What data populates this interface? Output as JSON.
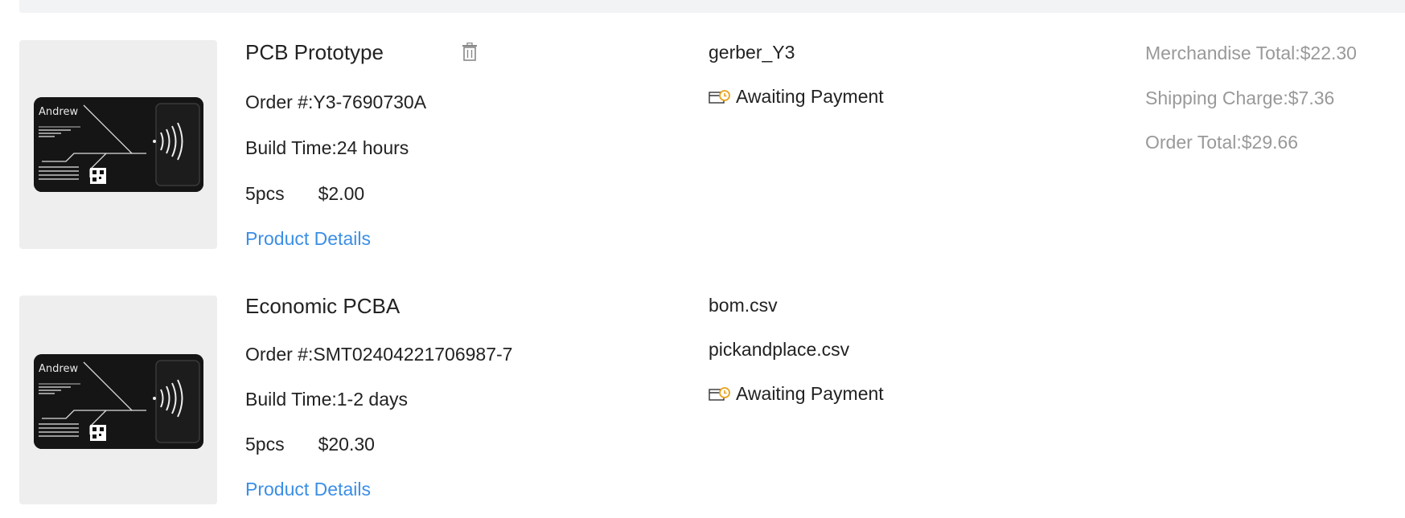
{
  "orders": [
    {
      "product": "PCB Prototype",
      "order_no": "Order #:Y3-7690730A",
      "build_time": "Build Time:24 hours",
      "qty": "5pcs",
      "price": "$2.00",
      "details_link": "Product Details",
      "files": [
        "gerber_Y3"
      ],
      "status": "Awaiting Payment",
      "merchandise_total": "Merchandise Total:$22.30",
      "shipping_charge": "Shipping Charge:$7.36",
      "order_total": "Order Total:$29.66",
      "card_name": "Andrew"
    },
    {
      "product": "Economic PCBA",
      "order_no": "Order #:SMT02404221706987-7",
      "build_time": "Build Time:1-2 days",
      "qty": "5pcs",
      "price": "$20.30",
      "details_link": "Product Details",
      "files": [
        "bom.csv",
        "pickandplace.csv"
      ],
      "status": "Awaiting Payment",
      "card_name": "Andrew"
    }
  ],
  "icons": {
    "delete": "trash-icon",
    "status": "awaiting-payment-icon"
  },
  "colors": {
    "link": "#3b8ee5",
    "muted": "#999999",
    "thumb_bg": "#eeeeee"
  }
}
